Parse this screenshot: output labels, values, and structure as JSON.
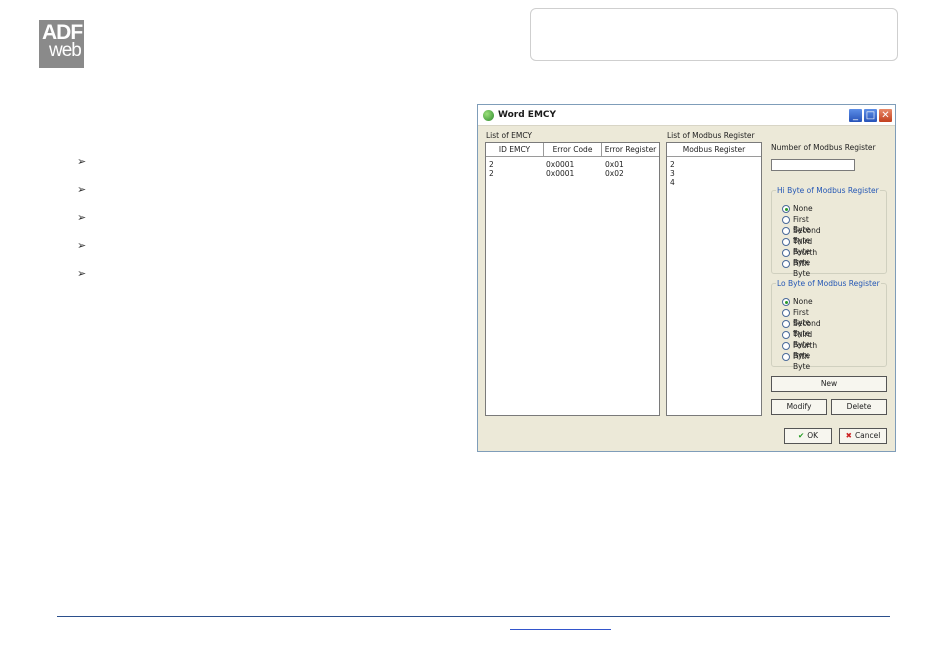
{
  "logo": {
    "line1": "ADF",
    "line2": "web"
  },
  "dialog": {
    "title": "Word EMCY",
    "emcy_list": {
      "label": "List of EMCY",
      "columns": [
        "ID EMCY",
        "Error Code",
        "Error Register"
      ],
      "rows": [
        [
          "2",
          "0x0001",
          "0x01"
        ],
        [
          "2",
          "0x0001",
          "0x02"
        ]
      ]
    },
    "modbus_list": {
      "label": "List of Modbus Register",
      "column": "Modbus Register",
      "rows": [
        "2",
        "3",
        "4"
      ]
    },
    "number_label": "Number of Modbus Register",
    "number_value": "",
    "hi_group": {
      "title": "Hi Byte of Modbus Register",
      "options": [
        "None",
        "First Byte",
        "Second Byte",
        "Third Byte",
        "Fourth Byte",
        "Fifth Byte"
      ],
      "selected": "None"
    },
    "lo_group": {
      "title": "Lo Byte of Modbus Register",
      "options": [
        "None",
        "First Byte",
        "Second Byte",
        "Third Byte",
        "Fourth Byte",
        "Fifth Byte"
      ],
      "selected": "None"
    },
    "buttons": {
      "new": "New",
      "modify": "Modify",
      "delete": "Delete",
      "ok": "OK",
      "cancel": "Cancel"
    }
  },
  "bullets": [
    "➢",
    "➢",
    "➢",
    "➢",
    "➢"
  ],
  "colors": {
    "logo_bg": "#8a8a8a",
    "footer_line": "#2b4f8c",
    "group_title": "#2457b5"
  }
}
